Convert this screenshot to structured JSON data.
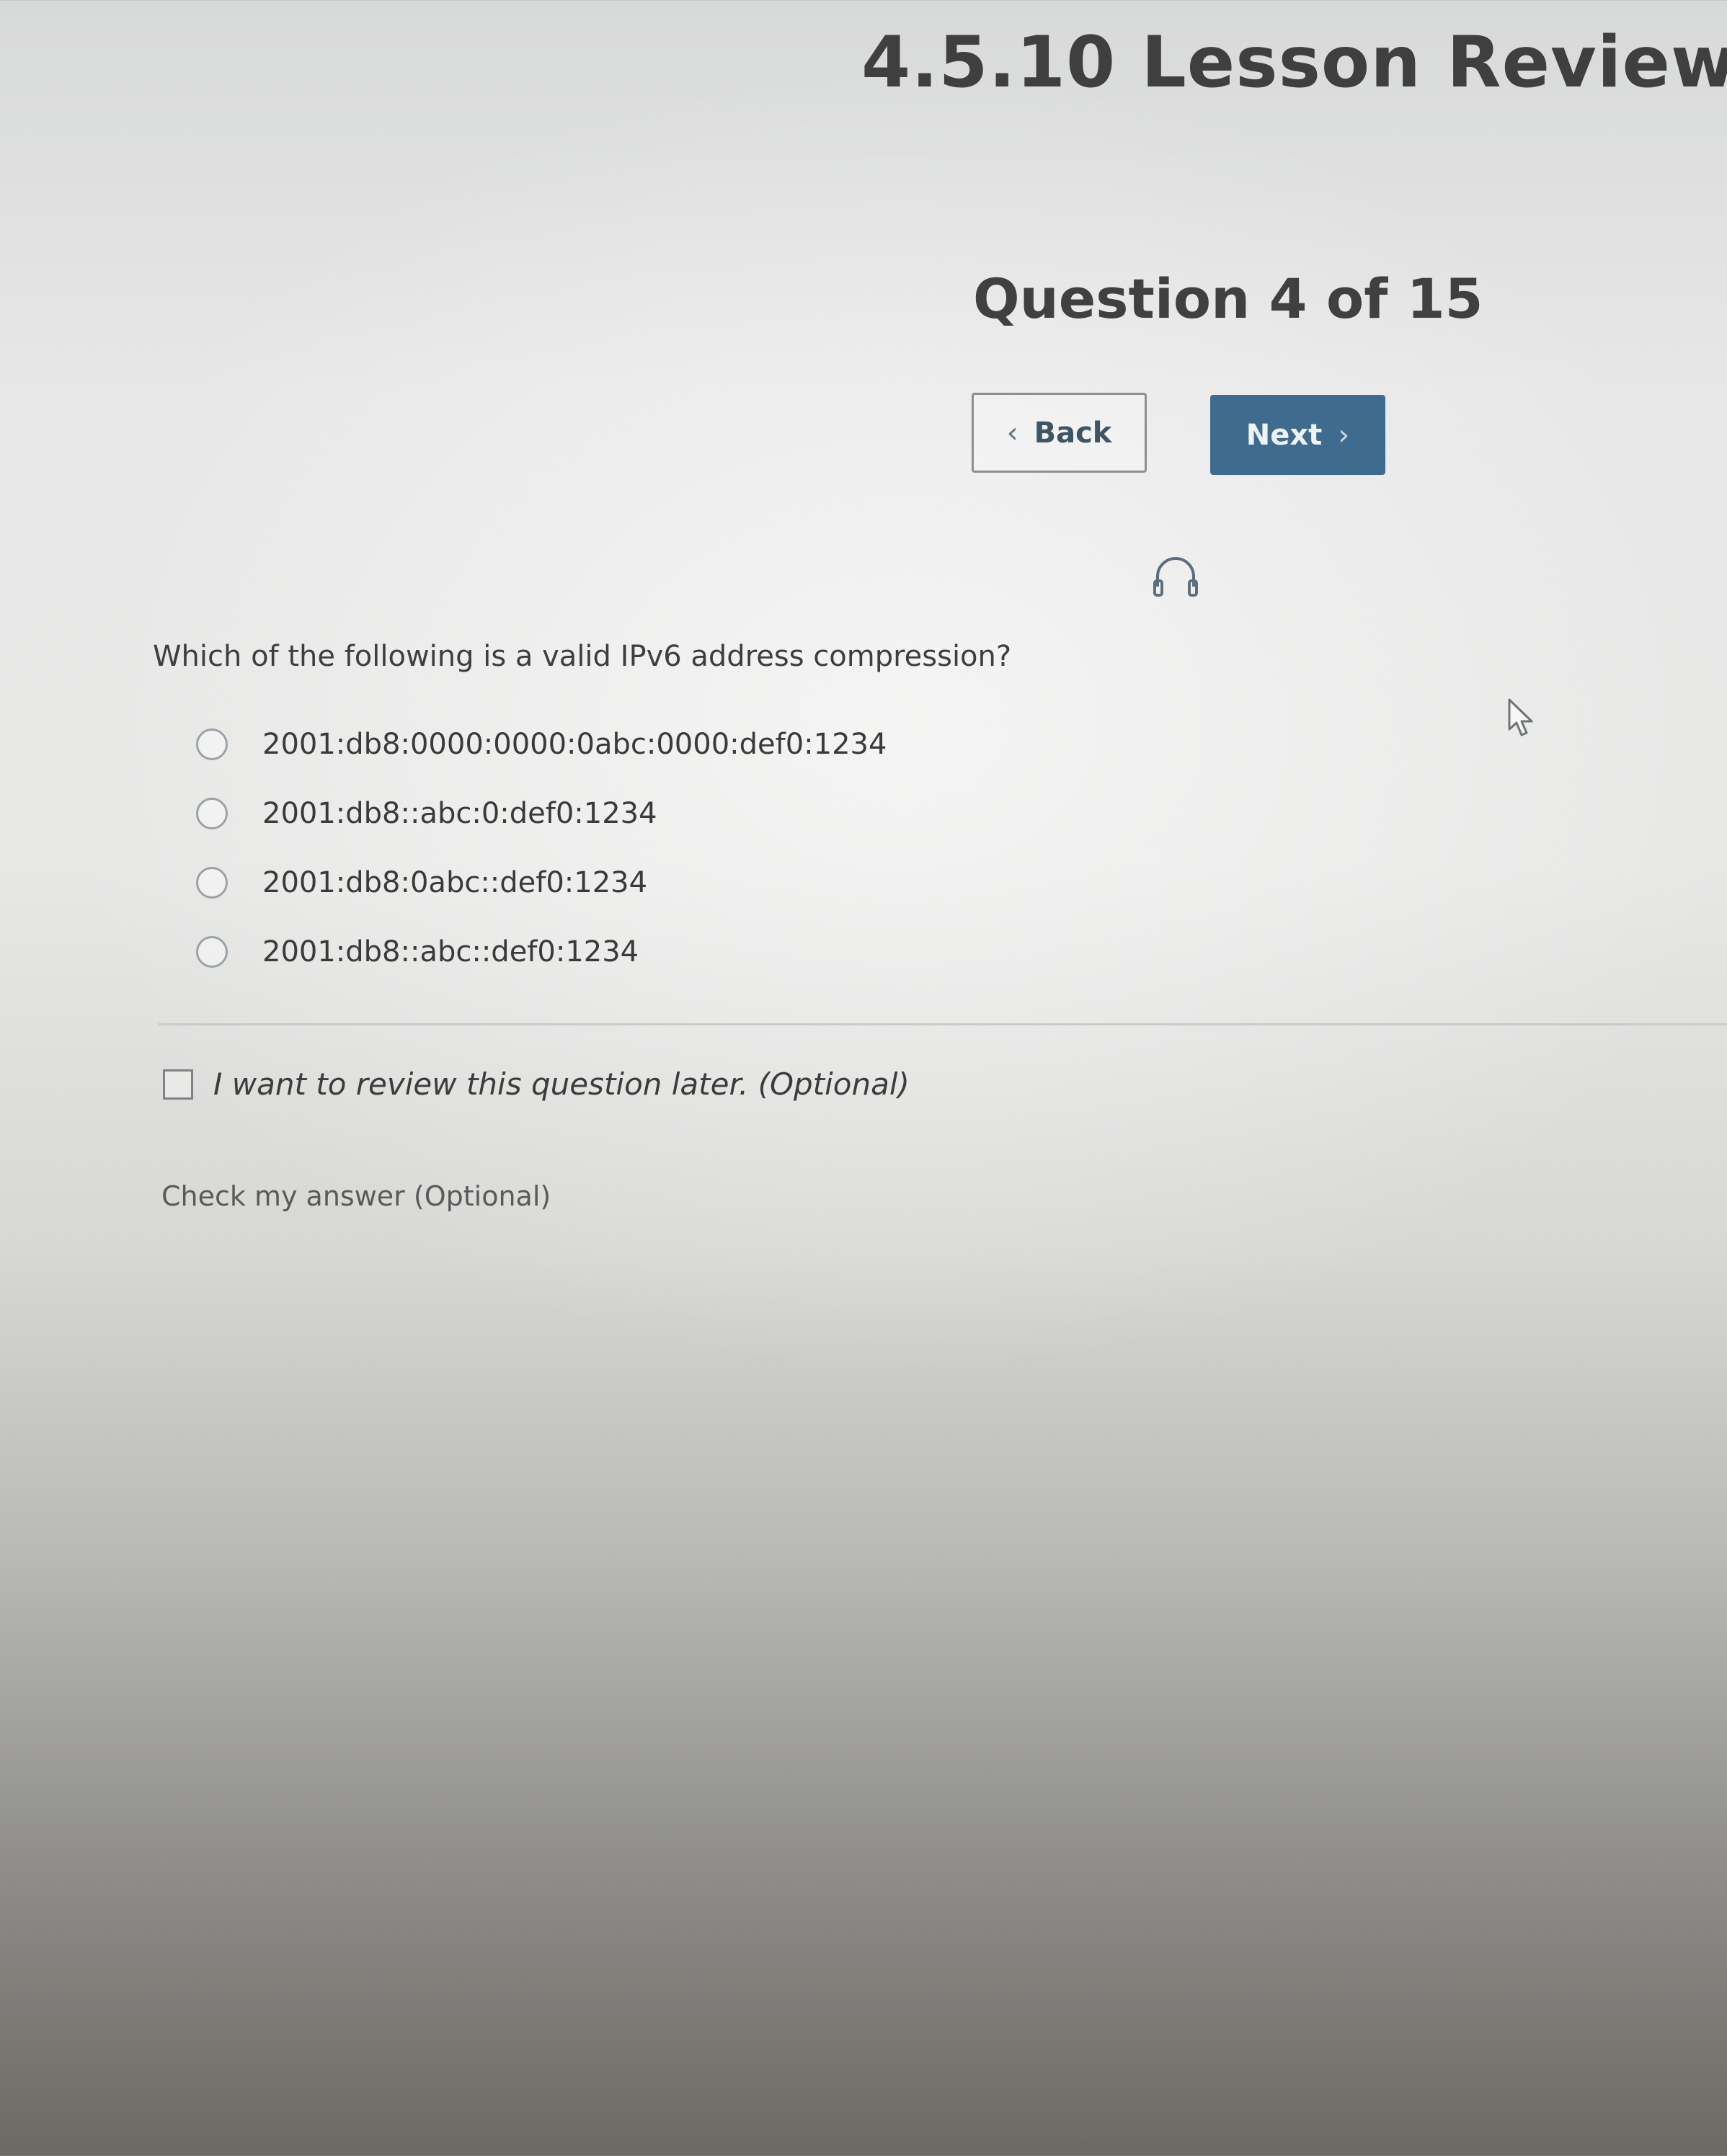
{
  "header": {
    "title": "4.5.10 Lesson Review",
    "question_counter": "Question 4 of 15"
  },
  "navigation": {
    "back_label": "Back",
    "next_label": "Next",
    "accent_color": "#3f6c8e"
  },
  "icons": {
    "audio": "headphones-icon",
    "back_chevron": "chevron-left-icon",
    "next_chevron": "chevron-right-icon",
    "pointer": "mouse-cursor-icon"
  },
  "question": {
    "prompt": "Which of the following is a valid IPv6 address compression?",
    "options": [
      "2001:db8:0000:0000:0abc:0000:def0:1234",
      "2001:db8::abc:0:def0:1234",
      "2001:db8:0abc::def0:1234",
      "2001:db8::abc::def0:1234"
    ]
  },
  "review": {
    "label": "I want to review this question later. (Optional)"
  },
  "check_answer": {
    "label": "Check my answer (Optional)"
  }
}
